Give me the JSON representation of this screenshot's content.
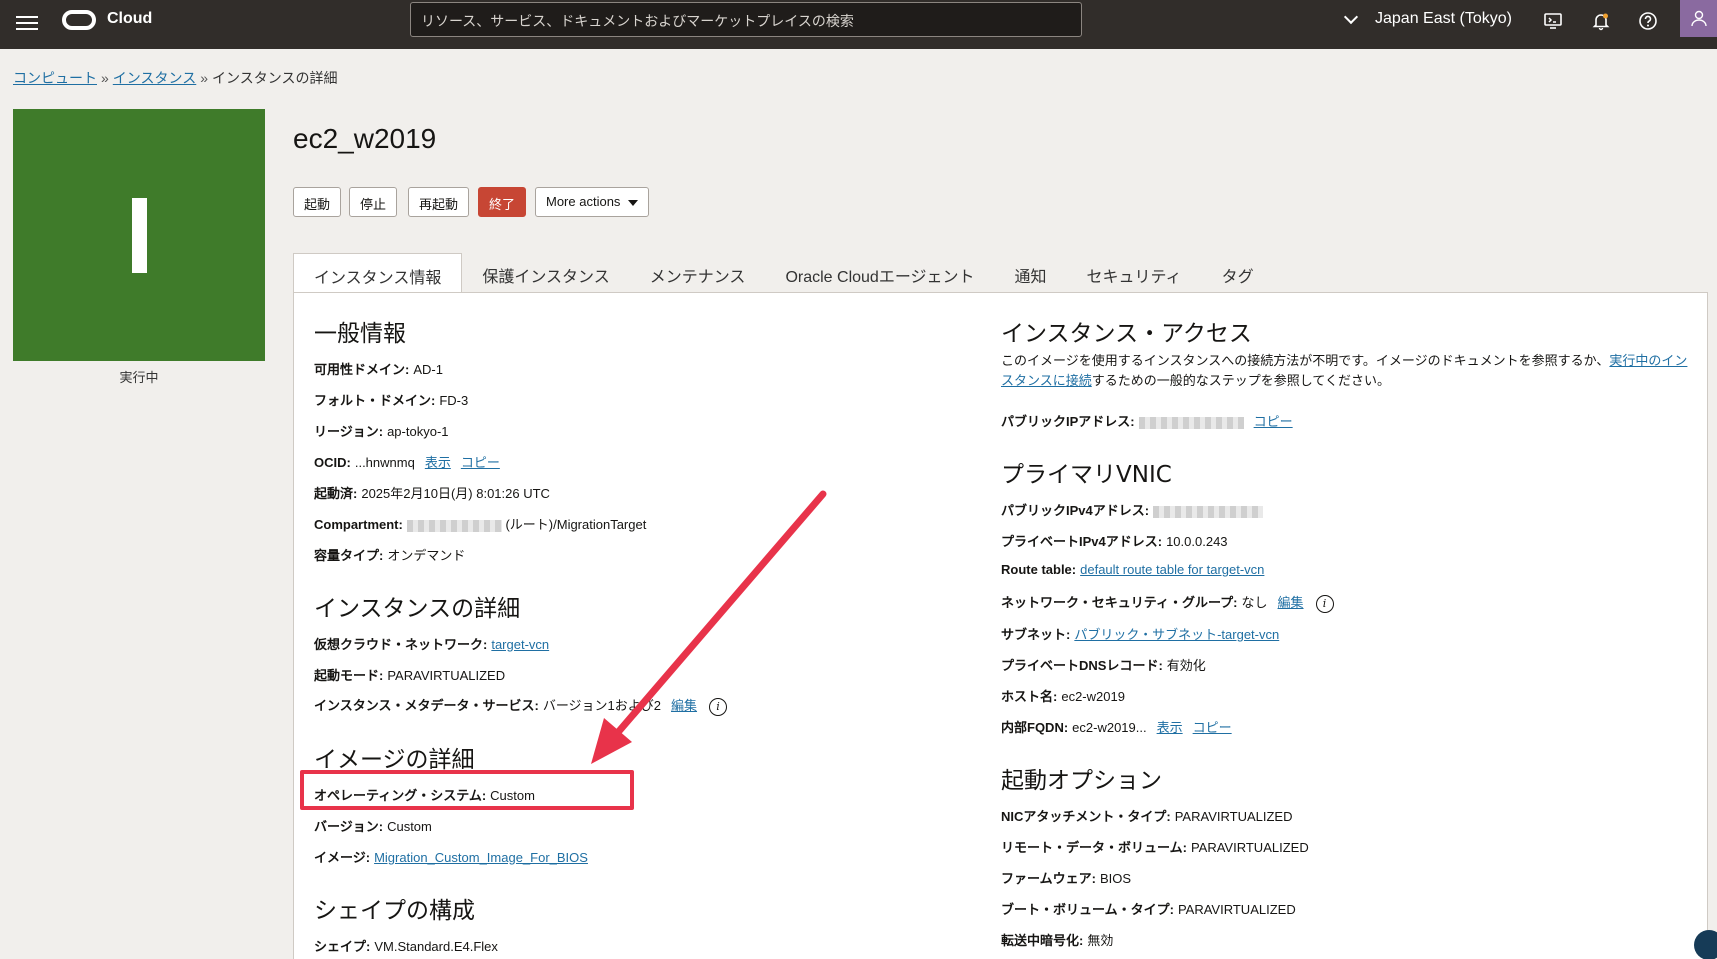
{
  "header": {
    "brand": "Cloud",
    "search_placeholder": "リソース、サービス、ドキュメントおよびマーケットプレイスの検索",
    "region": "Japan East (Tokyo)",
    "icons": [
      "menu-icon",
      "oracle-logo-icon",
      "chevron-down-icon",
      "cloud-shell-icon",
      "bell-icon",
      "help-icon",
      "user-icon"
    ]
  },
  "breadcrumb": {
    "items": [
      "コンピュート",
      "インスタンス"
    ],
    "separator": "»",
    "current": "インスタンスの詳細"
  },
  "instance": {
    "tile_letter": "I",
    "state": "実行中",
    "name": "ec2_w2019",
    "tile_color": "#3f7b2a"
  },
  "actions": {
    "start": "起動",
    "stop": "停止",
    "reboot": "再起動",
    "terminate": "終了",
    "more": "More actions"
  },
  "tabs": [
    "インスタンス情報",
    "保護インスタンス",
    "メンテナンス",
    "Oracle Cloudエージェント",
    "通知",
    "セキュリティ",
    "タグ"
  ],
  "general": {
    "title": "一般情報",
    "ad_label": "可用性ドメイン:",
    "ad_value": "AD-1",
    "fd_label": "フォルト・ドメイン:",
    "fd_value": "FD-3",
    "region_label": "リージョン:",
    "region_value": "ap-tokyo-1",
    "ocid_label": "OCID:",
    "ocid_value": "...hnwnmq",
    "show": "表示",
    "copy": "コピー",
    "launched_label": "起動済:",
    "launched_value": "2025年2月10日(月) 8:01:26 UTC",
    "compartment_label": "Compartment:",
    "compartment_value": "(ルート)/MigrationTarget",
    "capacity_label": "容量タイプ:",
    "capacity_value": "オンデマンド"
  },
  "instance_details": {
    "title": "インスタンスの詳細",
    "vcn_label": "仮想クラウド・ネットワーク:",
    "vcn_value": "target-vcn",
    "launch_mode_label": "起動モード:",
    "launch_mode_value": "PARAVIRTUALIZED",
    "imds_label": "インスタンス・メタデータ・サービス:",
    "imds_value": "バージョン1および2",
    "edit": "編集"
  },
  "image_details": {
    "title": "イメージの詳細",
    "os_label": "オペレーティング・システム:",
    "os_value": "Custom",
    "version_label": "バージョン:",
    "version_value": "Custom",
    "image_label": "イメージ:",
    "image_value": "Migration_Custom_Image_For_BIOS"
  },
  "shape": {
    "title": "シェイプの構成",
    "shape_label": "シェイプ:",
    "shape_value": "VM.Standard.E4.Flex"
  },
  "access": {
    "title": "インスタンス・アクセス",
    "text_pre": "このイメージを使用するインスタンスへの接続方法が不明です。イメージのドキュメントを参照するか、",
    "link": "実行中のインスタンスに接続",
    "text_post": "するための一般的なステップを参照してください。",
    "public_ip_label": "パブリックIPアドレス:",
    "copy": "コピー"
  },
  "vnic": {
    "title": "プライマリVNIC",
    "pub_ipv4_label": "パブリックIPv4アドレス:",
    "priv_ipv4_label": "プライベートIPv4アドレス:",
    "priv_ipv4_value": "10.0.0.243",
    "route_label": "Route table:",
    "route_value": "default route table for target-vcn",
    "nsg_label": "ネットワーク・セキュリティ・グループ:",
    "nsg_value": "なし",
    "edit": "編集",
    "subnet_label": "サブネット:",
    "subnet_value": "パブリック・サブネット-target-vcn",
    "dns_label": "プライベートDNSレコード:",
    "dns_value": "有効化",
    "host_label": "ホスト名:",
    "host_value": "ec2-w2019",
    "fqdn_label": "内部FQDN:",
    "fqdn_value": "ec2-w2019...",
    "show": "表示",
    "copy": "コピー"
  },
  "launch_options": {
    "title": "起動オプション",
    "nic_label": "NICアタッチメント・タイプ:",
    "nic_value": "PARAVIRTUALIZED",
    "remote_label": "リモート・データ・ボリューム:",
    "remote_value": "PARAVIRTUALIZED",
    "fw_label": "ファームウェア:",
    "fw_value": "BIOS",
    "boot_label": "ブート・ボリューム・タイプ:",
    "boot_value": "PARAVIRTUALIZED",
    "transit_label": "転送中暗号化:",
    "transit_value": "無効"
  },
  "annotation": {
    "color": "#e8334a"
  }
}
